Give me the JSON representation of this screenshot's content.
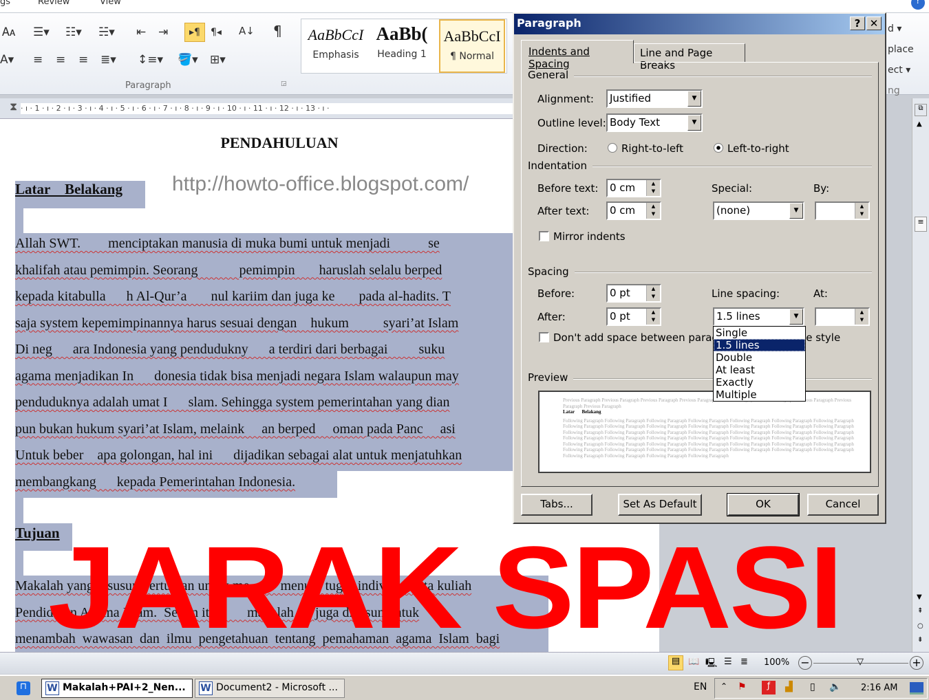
{
  "ribbon": {
    "tabs": [
      "gs",
      "Review",
      "View"
    ],
    "group_label": "Paragraph",
    "styles": [
      {
        "sample": "AaBbCcI",
        "label": "Emphasis"
      },
      {
        "sample": "AaBb(",
        "label": "Heading 1"
      },
      {
        "sample": "AaBbCcI",
        "label": "¶ Normal"
      }
    ],
    "right_items": [
      "d ▾",
      "place",
      "ect ▾",
      "ng"
    ]
  },
  "ruler": {
    "text": "· ı · 1 · ı · 2 · ı · 3 · ı · 4 · ı · 5 · ı · 6 · ı · 7 · ı · 8 · ı · 9 · ı · 10 · ı · 11 · ı · 12 · ı · 13 · ı ·"
  },
  "document": {
    "title": "PENDAHULUAN",
    "watermark_url": "http://howto-office.blogspot.com/",
    "heading1": "Latar    Belakang",
    "para1": [
      "Allah SWT.        menciptakan manusia di muka bumi untuk menjadi           se",
      "khalifah atau pemimpin. Seorang            pemimpin       haruslah selalu berped",
      "kepada kitabulla      h Al-Qur’a       nul kariim dan juga ke       pada al-hadits. T",
      "saja system kepemimpinannya harus sesuai dengan    hukum          syari’at Islam",
      "Di neg      ara Indonesia yang pendudukny      a terdiri dari berbagai         suku",
      "agama menjadikan In      donesia tidak bisa menjadi negara Islam walaupun may",
      "penduduknya adalah umat I      slam. Sehingga system pemerintahan yang dian",
      "pun bukan hukum syari’at Islam, melaink     an berped     oman pada Panc     asi",
      "Untuk beber    apa golongan, hal ini      dijadikan sebagai alat untuk menjatuhkan",
      "membangkang      kepada Pemerintahan Indonesia."
    ],
    "heading2": "Tujuan",
    "para2": [
      "Makalah yang disusun bertujuan untuk me         menuhi tugas individu mata kuliah",
      "Pendidikan Agama Islam.  Selain itu         makalah ini juga disusun untuk",
      "menambah  wawasan  dan  ilmu  pengetahuan  tentang  pemahaman  agama  Islam  bagi"
    ],
    "overlay_text": "JARAK SPASI"
  },
  "dialog": {
    "title": "Paragraph",
    "help": "?",
    "close": "✕",
    "tabs": [
      "Indents and Spacing",
      "Line and Page Breaks"
    ],
    "general": "General",
    "alignment_label": "Alignment:",
    "alignment": "Justified",
    "outline_label": "Outline level:",
    "outline": "Body Text",
    "direction_label": "Direction:",
    "rtl": "Right-to-left",
    "ltr": "Left-to-right",
    "indentation": "Indentation",
    "before_text_label": "Before text:",
    "before_text": "0 cm",
    "after_text_label": "After text:",
    "after_text": "0 cm",
    "special_label": "Special:",
    "special": "(none)",
    "by_label": "By:",
    "by": "",
    "mirror": "Mirror indents",
    "spacing": "Spacing",
    "before_label": "Before:",
    "before": "0 pt",
    "after_label": "After:",
    "after": "0 pt",
    "line_spacing_label": "Line spacing:",
    "line_spacing": "1.5 lines",
    "at_label": "At:",
    "at": "",
    "dont_add": "Don't add space between paragraphs of the same style",
    "line_spacing_options": [
      "Single",
      "1.5 lines",
      "Double",
      "At least",
      "Exactly",
      "Multiple"
    ],
    "preview": "Preview",
    "preview_prev": "Previous Paragraph Previous Paragraph Previous Paragraph Previous Paragraph Previous Paragraph Previous Paragraph Previous Paragraph Previous Paragraph Previous Paragraph",
    "preview_cur": "Latar      Belakang",
    "preview_next": "Following Paragraph Following Paragraph Following Paragraph Following Paragraph Following Paragraph Following Paragraph Following Paragraph Following Paragraph Following Paragraph Following Paragraph Following Paragraph Following Paragraph Following Paragraph Following Paragraph Following Paragraph Following Paragraph Following Paragraph Following Paragraph Following Paragraph Following Paragraph Following Paragraph Following Paragraph Following Paragraph Following Paragraph Following Paragraph Following Paragraph Following Paragraph Following Paragraph Following Paragraph Following Paragraph Following Paragraph Following Paragraph Following Paragraph Following Paragraph Following Paragraph Following Paragraph Following Paragraph Following Paragraph Following Paragraph Following Paragraph Following Paragraph Following Paragraph Following Paragraph Following Paragraph Following Paragraph Following Paragraph",
    "tabs_button": "Tabs...",
    "default_button": "Set As Default",
    "ok": "OK",
    "cancel": "Cancel"
  },
  "status": {
    "zoom": "100%",
    "zoom_level_percent": 100
  },
  "taskbar": {
    "items": [
      "Makalah+PAI+2_Nen...",
      "Document2 - Microsoft ..."
    ],
    "lang": "EN",
    "time": "2:16 AM"
  },
  "colors": {
    "selection": "#a8b1cb",
    "overlay": "#ff0000",
    "title_bar": "#0a246a",
    "dialog_bg": "#d4d0c8"
  }
}
